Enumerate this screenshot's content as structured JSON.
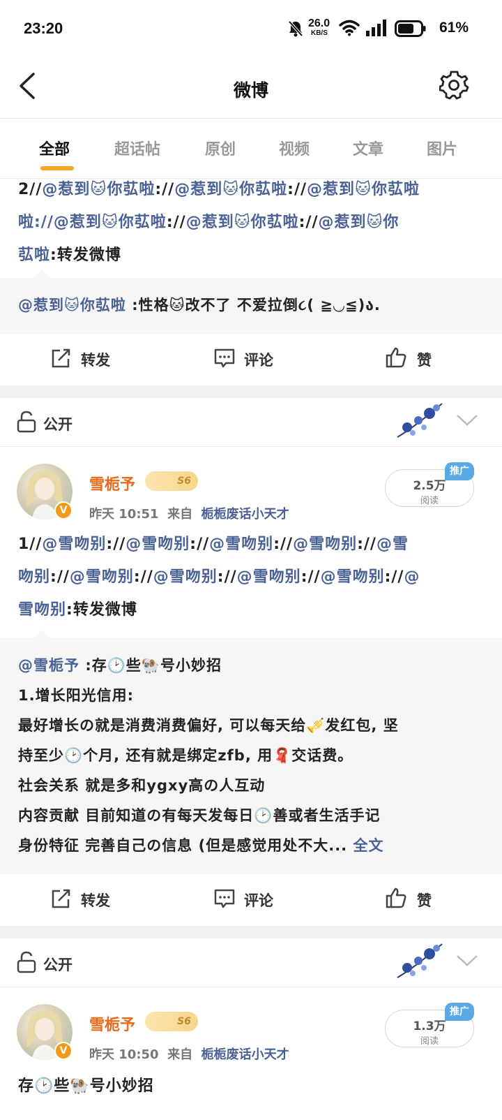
{
  "status_bar": {
    "time": "23:20",
    "net_speed": "26.0",
    "net_unit": "KB/S",
    "battery": "61%"
  },
  "nav": {
    "title": "微博"
  },
  "tabs": [
    "全部",
    "超话帖",
    "原创",
    "视频",
    "文章",
    "图片"
  ],
  "post0": {
    "line1_prefix": "2//",
    "line1_at": "@惹到🐱你苰啦",
    "line1_sep": "://",
    "line2_a": "啦://",
    "line2_at": "@惹到🐱你苰啦",
    "line2_sep": "://",
    "line2_tail_at": "@惹到🐱你",
    "line3_at": "苰啦",
    "line3_tail": ":转发微博",
    "quote_at": "@惹到🐱你苰啦",
    "quote_text": ":性格🐱改不了 不爱拉倒૮( ≧◡≦)ა."
  },
  "actions": {
    "repost": "转发",
    "comment": "评论",
    "like": "赞"
  },
  "visibility": "公开",
  "post1": {
    "user": "雪栀予",
    "level": "S6",
    "time": "昨天 10:51",
    "from_label": "来自",
    "source": "栀栀废话小天才",
    "reads": "2.5万",
    "reads_label": "阅读",
    "promo": "推广",
    "line1_prefix": "1//",
    "at": "@雪吻别",
    "sep": "://",
    "line2_lead": "吻别",
    "line3_lead": "雪吻别",
    "line3_tail": ":转发微博",
    "quote_at": "@雪栀予",
    "quote_l1": ":存🕑些🐏号小妙招",
    "quote_l2": "1.增长阳光信用:",
    "quote_l3": "最好增长の就是消费消费偏好, 可以每天给🎺发红包, 坚",
    "quote_l4": "持至少🕑个月, 还有就是绑定zfb, 用🧣交话费。",
    "quote_l5": "社会关系 就是多和ygxy高の人互动",
    "quote_l6": "内容贡献 目前知道の有每天发每日🕑善或者生活手记",
    "quote_l7": "身份特征 完善自己の信息 (但是感觉用处不大...",
    "full_text": "全文"
  },
  "post2": {
    "user": "雪栀予",
    "level": "S6",
    "time": "昨天 10:50",
    "from_label": "来自",
    "source": "栀栀废话小天才",
    "reads": "1.3万",
    "reads_label": "阅读",
    "promo": "推广",
    "text": "存🕑些🐏号小妙招"
  },
  "colors": {
    "accent": "#f5a623",
    "link": "#4a6196",
    "username": "#ea6b1c",
    "promo": "#5aa9e6"
  }
}
